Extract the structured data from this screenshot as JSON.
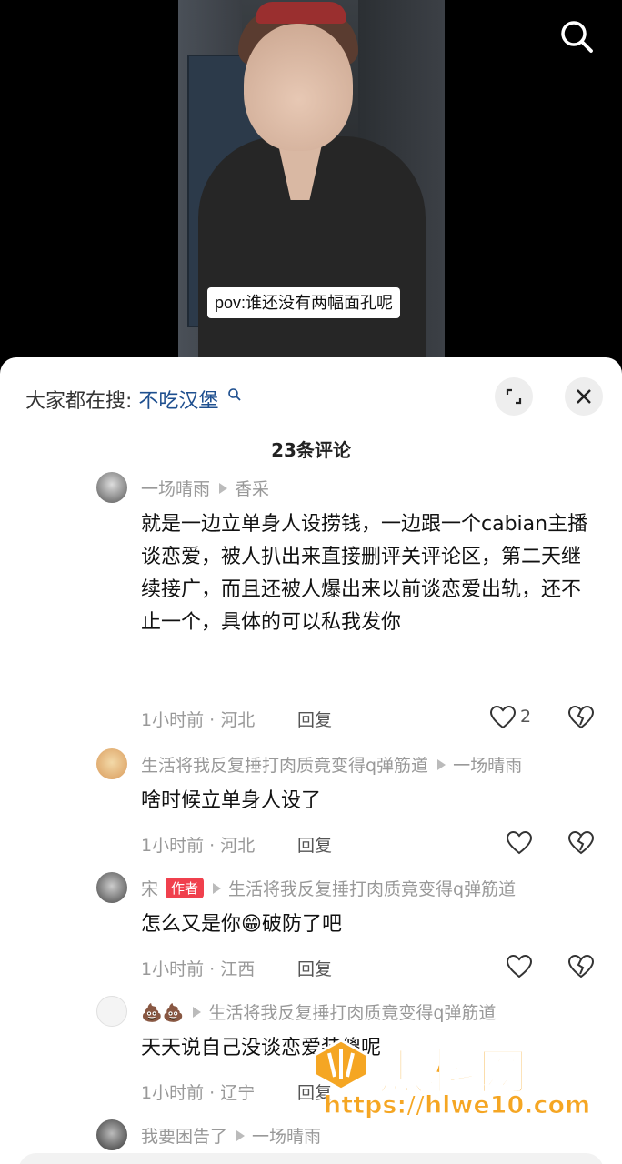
{
  "video": {
    "caption": "pov:谁还没有两幅面孔呢"
  },
  "top_bar": {
    "search_icon": "search-icon"
  },
  "sheet": {
    "trend_prefix": "大家都在搜:",
    "trend_keyword": "不吃汉堡",
    "comment_count": "23条评论"
  },
  "comments": [
    {
      "user": "一场晴雨",
      "reply_to": "香采",
      "text": "就是一边立单身人设捞钱，一边跟一个cabian主播谈恋爱，被人扒出来直接删评关评论区，第二天继续接广，而且还被人爆出来以前谈恋爱出轨，还不止一个，具体的可以私我发你",
      "time": "1小时前 · 河北",
      "reply_label": "回复",
      "likes": "2"
    },
    {
      "user": "生活将我反复捶打肉质竟变得q弹筋道",
      "reply_to": "一场晴雨",
      "text": "啥时候立单身人设了",
      "time": "1小时前 · 河北",
      "reply_label": "回复",
      "likes": ""
    },
    {
      "user": "宋",
      "author_tag": "作者",
      "reply_to": "生活将我反复捶打肉质竟变得q弹筋道",
      "text_before": "怎么又是你",
      "emoji": "😁",
      "text_after": "破防了吧",
      "time": "1小时前 · 江西",
      "reply_label": "回复",
      "likes": ""
    },
    {
      "user": "💩💩",
      "reply_to": "生活将我反复捶打肉质竟变得q弹筋道",
      "text": "天天说自己没谈恋爱装傻呢",
      "time": "1小时前 · 辽宁",
      "reply_label": "回复",
      "likes": ""
    },
    {
      "user": "我要困告了",
      "reply_to": "一场晴雨"
    }
  ],
  "watermark": {
    "title": "黑料网",
    "url": "https://hlwe10.com"
  },
  "colors": {
    "accent_link": "#1e4f8f",
    "author_tag": "#f0404d",
    "watermark": "#f5a623"
  }
}
